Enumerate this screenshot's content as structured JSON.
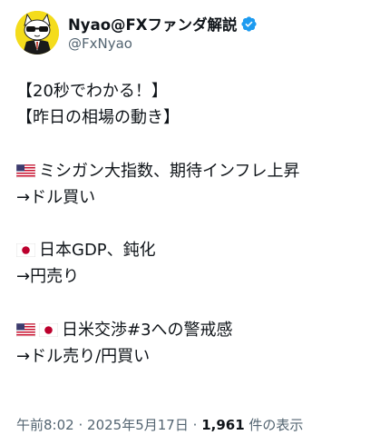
{
  "author": {
    "display_name": "Nyao@FXファンダ解説",
    "handle": "@FxNyao",
    "verified": true,
    "avatar_icon": "cat-with-sunglasses-avatar",
    "verified_color": "#1d9bf0"
  },
  "tweet": {
    "lines": [
      "【20秒でわかる！】",
      "【昨日の相場の動き】",
      "",
      "ミシガン大指数、期待インフレ上昇",
      "→ドル買い",
      "",
      "日本GDP、鈍化",
      "→円売り",
      "",
      "日米交渉#3への警戒感",
      "→ドル売り/円買い"
    ],
    "flags": {
      "line3": [
        "us-flag-icon"
      ],
      "line6": [
        "japan-flag-icon"
      ],
      "line9": [
        "us-flag-icon",
        "japan-flag-icon"
      ]
    }
  },
  "meta": {
    "time": "午前8:02",
    "separator": "·",
    "date": "2025年5月17日",
    "views_count": "1,961",
    "views_label": "件の表示"
  },
  "colors": {
    "text": "#0f1419",
    "secondary": "#536471",
    "accent": "#1d9bf0"
  }
}
